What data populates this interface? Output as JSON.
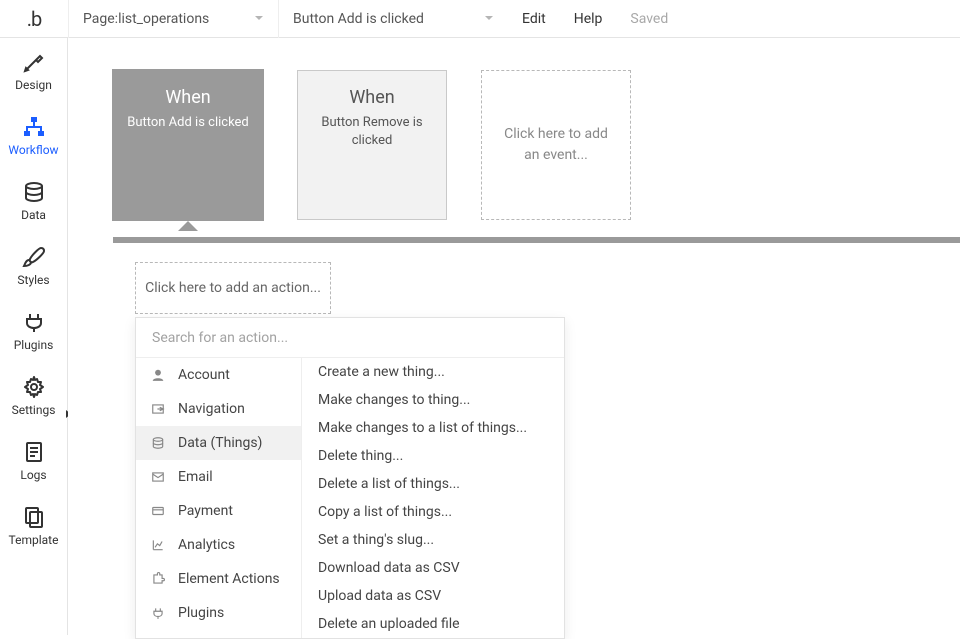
{
  "topbar": {
    "page_label_prefix": "Page: ",
    "page_name": "list_operations",
    "event_name": "Button Add is clicked",
    "edit": "Edit",
    "help": "Help",
    "saved": "Saved"
  },
  "sidebar": {
    "items": [
      {
        "key": "design",
        "label": "Design"
      },
      {
        "key": "workflow",
        "label": "Workflow"
      },
      {
        "key": "data",
        "label": "Data"
      },
      {
        "key": "styles",
        "label": "Styles"
      },
      {
        "key": "plugins",
        "label": "Plugins"
      },
      {
        "key": "settings",
        "label": "Settings"
      },
      {
        "key": "logs",
        "label": "Logs"
      },
      {
        "key": "template",
        "label": "Template"
      }
    ]
  },
  "events": {
    "when_word": "When",
    "items": [
      {
        "desc": "Button Add is clicked",
        "selected": true
      },
      {
        "desc": "Button Remove is clicked",
        "selected": false
      }
    ],
    "add_placeholder": "Click here to add an event..."
  },
  "actions": {
    "add_placeholder": "Click here to add an action...",
    "search_placeholder": "Search for an action...",
    "categories": [
      {
        "key": "account",
        "label": "Account"
      },
      {
        "key": "navigation",
        "label": "Navigation"
      },
      {
        "key": "data",
        "label": "Data (Things)",
        "selected": true
      },
      {
        "key": "email",
        "label": "Email"
      },
      {
        "key": "payment",
        "label": "Payment"
      },
      {
        "key": "analytics",
        "label": "Analytics"
      },
      {
        "key": "element",
        "label": "Element Actions"
      },
      {
        "key": "plugins",
        "label": "Plugins"
      }
    ],
    "data_actions": [
      "Create a new thing...",
      "Make changes to thing...",
      "Make changes to a list of things...",
      "Delete thing...",
      "Delete a list of things...",
      "Copy a list of things...",
      "Set a thing's slug...",
      "Download data as CSV",
      "Upload data as CSV",
      "Delete an uploaded file"
    ]
  },
  "logo_text": ".b"
}
